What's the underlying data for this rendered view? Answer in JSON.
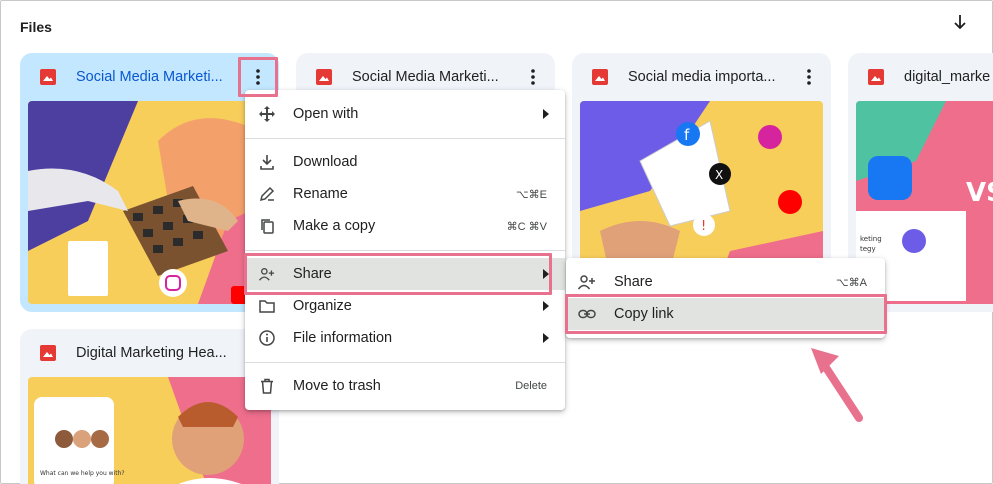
{
  "header": {
    "title": "Files",
    "sort_icon": "arrow-down-icon"
  },
  "colors": {
    "accent": "#e8728e",
    "selected_bg": "#c2e7ff",
    "card_bg": "#f0f4f9",
    "pdf_red": "#e53935",
    "link_blue": "#0b57d0"
  },
  "cards": [
    {
      "title": "Social Media Marketi...",
      "icon": "pdf-icon",
      "selected": true
    },
    {
      "title": "Social Media Marketi...",
      "icon": "pdf-icon",
      "selected": false
    },
    {
      "title": "Social media importa...",
      "icon": "pdf-icon",
      "selected": false
    },
    {
      "title": "digital_marke",
      "icon": "pdf-icon",
      "selected": false
    },
    {
      "title": "Digital Marketing Hea...",
      "icon": "pdf-icon",
      "selected": false
    }
  ],
  "context_menu": {
    "items": [
      {
        "label": "Open with",
        "icon": "move-icon",
        "shortcut": "",
        "submenu": true
      },
      {
        "label": "Download",
        "icon": "download-icon",
        "shortcut": "",
        "submenu": false
      },
      {
        "label": "Rename",
        "icon": "pencil-icon",
        "shortcut": "⌥⌘E",
        "submenu": false
      },
      {
        "label": "Make a copy",
        "icon": "copy-icon",
        "shortcut": "⌘C ⌘V",
        "submenu": false
      },
      {
        "label": "Share",
        "icon": "add-person-icon",
        "shortcut": "",
        "submenu": true
      },
      {
        "label": "Organize",
        "icon": "folder-icon",
        "shortcut": "",
        "submenu": true
      },
      {
        "label": "File information",
        "icon": "info-icon",
        "shortcut": "",
        "submenu": true
      },
      {
        "label": "Move to trash",
        "icon": "trash-icon",
        "shortcut": "Delete",
        "submenu": false
      }
    ]
  },
  "share_submenu": {
    "items": [
      {
        "label": "Share",
        "icon": "add-person-icon",
        "shortcut": "⌥⌘A"
      },
      {
        "label": "Copy link",
        "icon": "link-icon",
        "shortcut": ""
      }
    ]
  },
  "thumb_text": {
    "card3_icons": [
      "f",
      "X",
      "!",
      "P"
    ],
    "card4_text": "VS",
    "card4_caption": [
      "keting",
      "tegy"
    ],
    "card5_caption": "What can we help you with?"
  }
}
